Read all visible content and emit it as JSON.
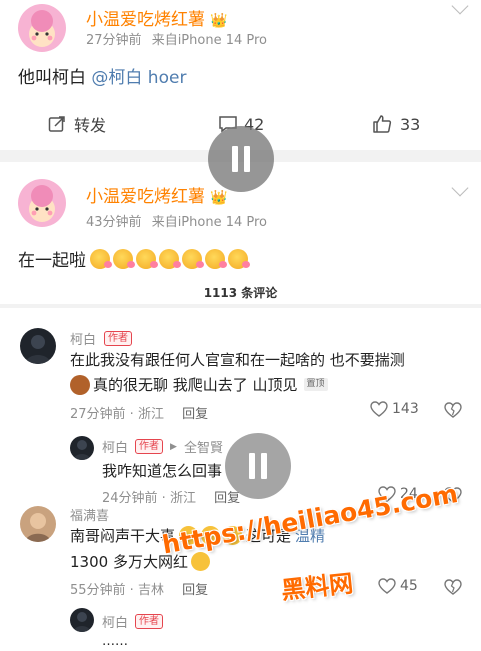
{
  "post1": {
    "username": "小温爱吃烤红薯",
    "crown_icon": "crown-icon",
    "time": "27分钟前",
    "source": "来自iPhone 14 Pro",
    "text_prefix": "他叫柯白 ",
    "mention": "@柯白 hoer",
    "share_label": "转发",
    "comment_count": "42",
    "like_count": "33"
  },
  "post2": {
    "username": "小温爱吃烤红薯",
    "time": "43分钟前",
    "source": "来自iPhone 14 Pro",
    "text": "在一起啦",
    "emoji_count": 7
  },
  "comments_header": "1113 条评论",
  "comments": [
    {
      "name": "柯白",
      "tag": "作者",
      "text_line1": "在此我没有跟任何人官宣和在一起啥的 也不要揣测",
      "text_line2": "真的很无聊 我爬山去了 山顶见",
      "pin": "置顶",
      "time": "27分钟前 · 浙江",
      "reply": "回复",
      "likes": "143"
    },
    {
      "name": "柯白",
      "tag": "作者",
      "to": "全智賢",
      "text": "我咋知道怎么回事",
      "time": "24分钟前 · 浙江",
      "reply": "回复",
      "likes": "24"
    },
    {
      "name": "福满喜",
      "text_line1_a": "南哥闷声干大事",
      "text_line1_b": "这可是",
      "mention": "温精",
      "text_line2": "1300 多万大网红",
      "time": "55分钟前 · 吉林",
      "reply": "回复",
      "likes": "45"
    },
    {
      "name": "柯白",
      "tag": "作者",
      "text": "……"
    }
  ],
  "watermark": {
    "url": "https://heiliao45.com",
    "name": "黑料网"
  },
  "colors": {
    "username": "#ff8200",
    "mention": "#507daf",
    "author_tag": "#e5454e",
    "watermark": "#ff6a00"
  }
}
